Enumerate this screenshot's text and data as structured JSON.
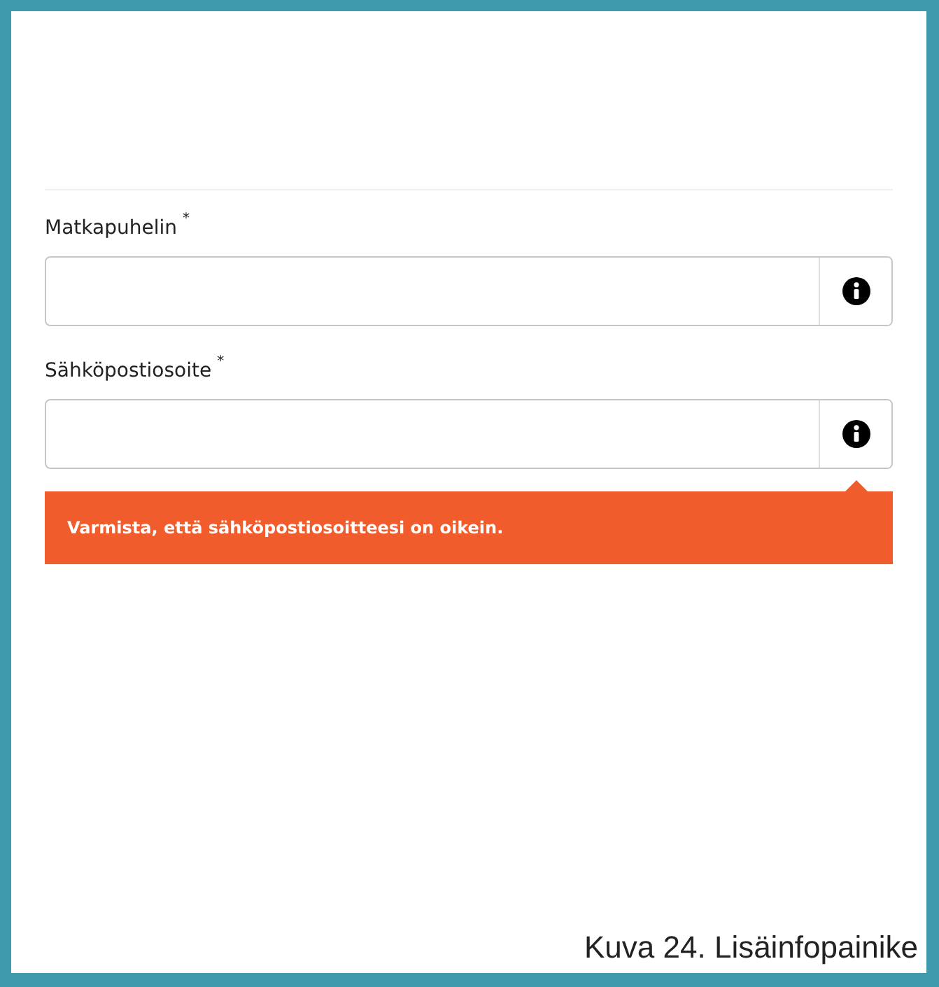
{
  "fields": [
    {
      "label": "Matkapuhelin",
      "required_mark": "*"
    },
    {
      "label": "Sähköpostiosoite",
      "required_mark": "*",
      "help": "Varmista, että sähköpostiosoitteesi on oikein."
    }
  ],
  "caption": "Kuva 24. Lisäinfopainike"
}
